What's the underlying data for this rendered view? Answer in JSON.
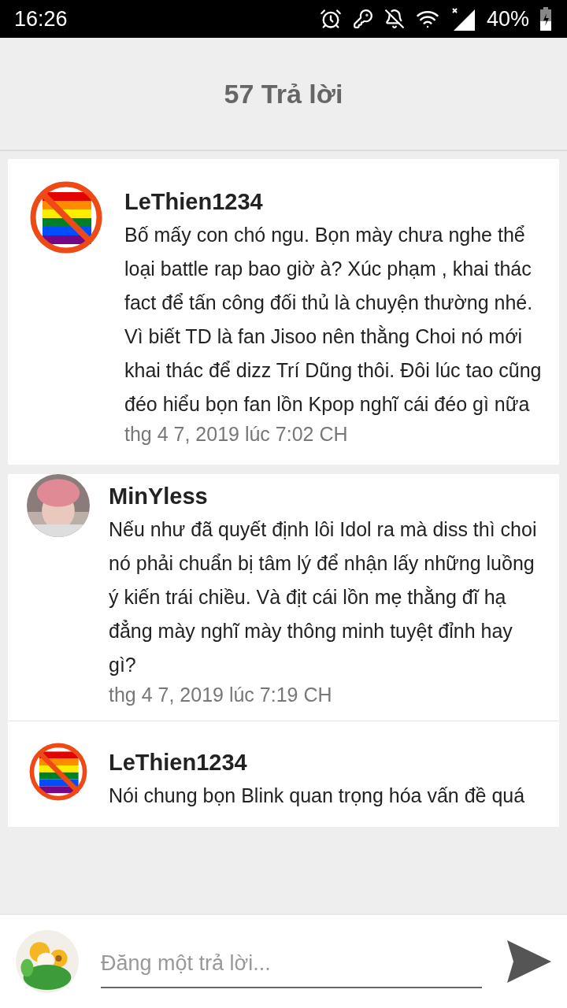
{
  "status_bar": {
    "time": "16:26",
    "battery": "40%"
  },
  "header": {
    "title": "57 Trả lời"
  },
  "post": {
    "author": "LeThien1234",
    "text": "Bố mấy con chó ngu. Bọn mày chưa nghe thể loại battle rap bao giờ à? Xúc phạm , khai thác fact để tấn công đối thủ là chuyện thường nhé. Vì biết TD là fan Jisoo nên thằng Choi nó mới khai thác để dizz Trí Dũng thôi. Đôi lúc tao cũng đéo hiểu bọn fan lồn Kpop nghĩ cái đéo gì nữa",
    "date": "thg 4 7, 2019 lúc 7:02 CH"
  },
  "replies": [
    {
      "author": "MinYless",
      "text": "Nếu như đã quyết định lôi Idol ra mà diss thì choi nó phải chuẩn bị tâm lý để nhận lấy những luồng ý kiến trái chiều. Và địt cái lồn mẹ thằng đĩ hạ đẳng mày nghĩ mày thông minh tuyệt đỉnh hay gì?",
      "date": "thg 4 7, 2019 lúc 7:19 CH"
    },
    {
      "author": "LeThien1234",
      "text": "Nói chung bọn Blink quan trọng hóa vấn đề quá"
    }
  ],
  "composer": {
    "placeholder": "Đăng một trả lời..."
  }
}
